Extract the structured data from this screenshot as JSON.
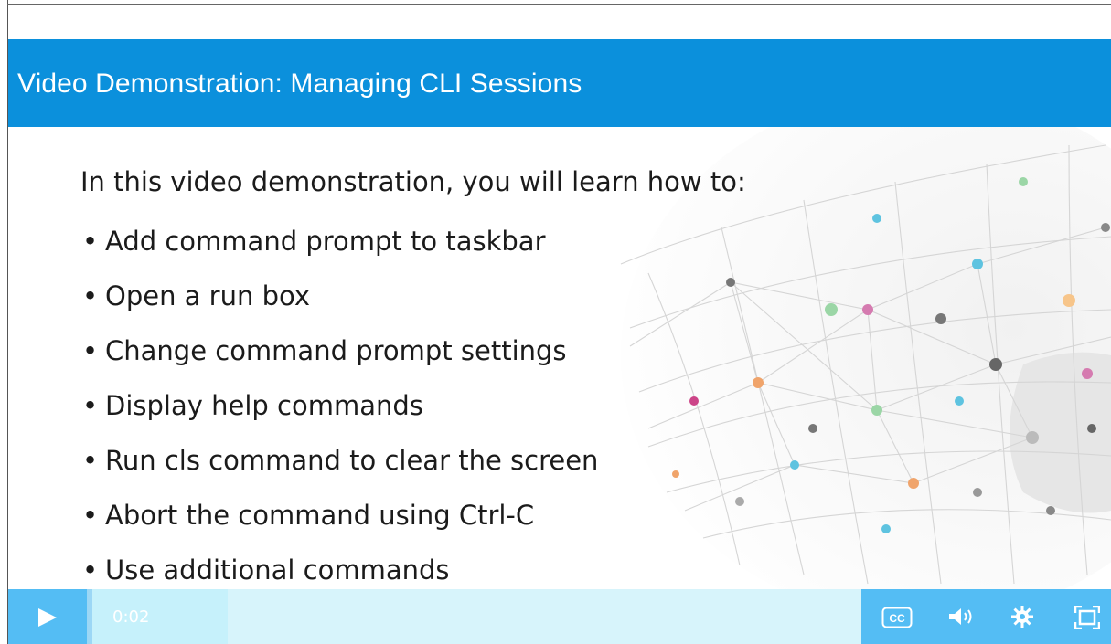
{
  "slide": {
    "title": "Video Demonstration: Managing CLI Sessions",
    "intro": "In this video demonstration, you will learn how to:",
    "bullets": [
      "Add command prompt to taskbar",
      "Open a run box",
      "Change command prompt settings",
      "Display help commands",
      "Run cls command to clear the screen",
      "Abort the command using Ctrl-C",
      "Use additional commands"
    ]
  },
  "player": {
    "current_time": "0:02",
    "progress_fraction": 0.03,
    "controls": {
      "play_icon": "play-icon",
      "captions_label": "CC",
      "captions_icon": "closed-captions-icon",
      "volume_icon": "volume-icon",
      "settings_icon": "gear-icon",
      "fullscreen_icon": "fullscreen-icon"
    }
  },
  "colors": {
    "title_bar": "#0b90dc",
    "control_bar": "#54bdf4",
    "scrubber_track": "#d7f4fb"
  }
}
